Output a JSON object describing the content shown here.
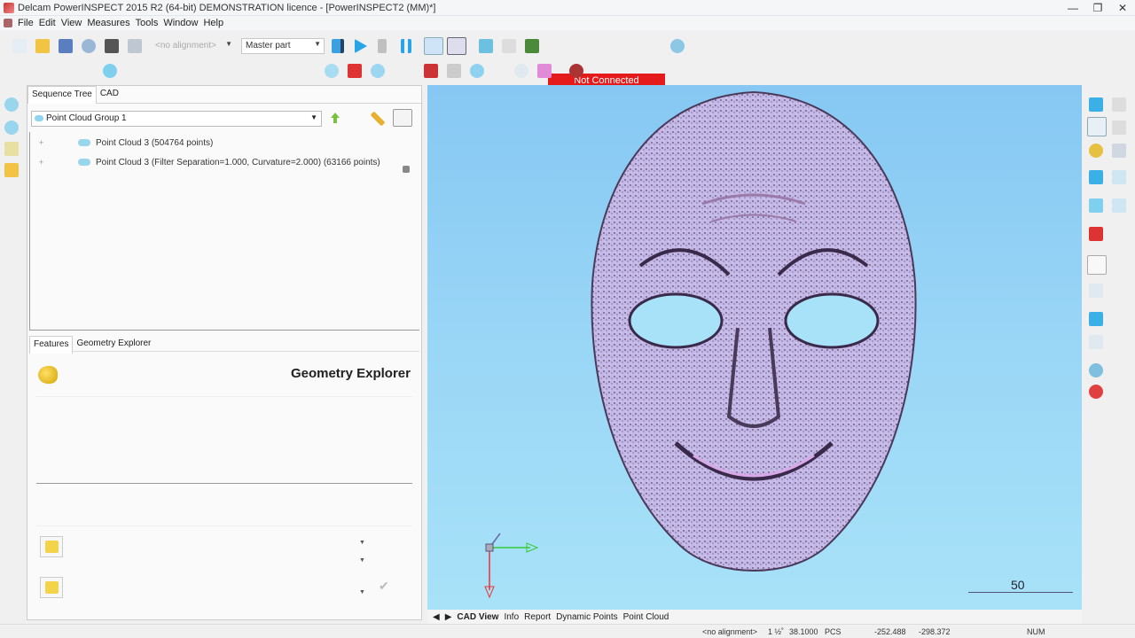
{
  "window": {
    "title": "Delcam PowerINSPECT 2015 R2 (64-bit) DEMONSTRATION licence - [PowerINSPECT2 (MM)*]"
  },
  "menu": {
    "items": [
      "File",
      "Edit",
      "View",
      "Measures",
      "Tools",
      "Window",
      "Help"
    ]
  },
  "toolbar": {
    "alignment_placeholder": "<no alignment>",
    "part_select": "Master part",
    "connection_status": "Not Connected",
    "connection_color": "#e51b1b"
  },
  "left_panel": {
    "top_tabs": [
      "Sequence Tree",
      "CAD"
    ],
    "group_select": "Point Cloud Group 1",
    "tree_rows": [
      "Point Cloud 3 (504764 points)",
      "Point Cloud 3 (Filter Separation=1.000, Curvature=2.000) (63166 points)"
    ],
    "bottom_tabs": [
      "Features",
      "Geometry Explorer"
    ],
    "geometry_title": "Geometry Explorer"
  },
  "viewport": {
    "scale_label": "50",
    "tabs": [
      "CAD View",
      "Info",
      "Report",
      "Dynamic Points",
      "Point Cloud"
    ]
  },
  "statusbar": {
    "alignment": "<no alignment>",
    "unit": "1 ½˚",
    "value": "38.1000",
    "pcs": "PCS",
    "x": "-252.488",
    "y": "-298.372",
    "num": "NUM"
  }
}
